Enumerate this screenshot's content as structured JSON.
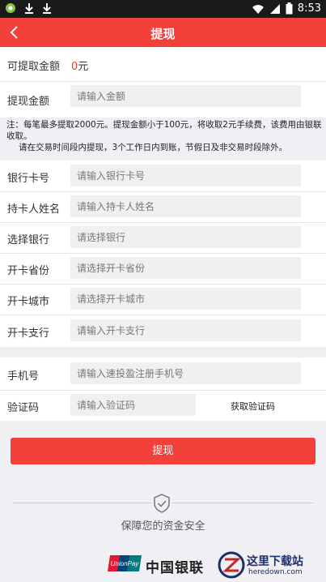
{
  "status": {
    "time": "8:53"
  },
  "header": {
    "title": "提现"
  },
  "available": {
    "label": "可提取金额",
    "value": "0",
    "unit": "元"
  },
  "amount": {
    "label": "提现金额",
    "placeholder": "请输入金额"
  },
  "notice": {
    "line1": "注：每笔最多提取2000元。提现金额小于100元，将收取2元手续费，该费用由银联收取。",
    "line2": "请在交易时间段内提现，3个工作日内到账，节假日及非交易时段除外。"
  },
  "card_number": {
    "label": "银行卡号",
    "placeholder": "请输入银行卡号"
  },
  "holder_name": {
    "label": "持卡人姓名",
    "placeholder": "请输入持卡人姓名"
  },
  "bank": {
    "label": "选择银行",
    "placeholder": "请选择银行"
  },
  "province": {
    "label": "开卡省份",
    "placeholder": "请选择开卡省份"
  },
  "city": {
    "label": "开卡城市",
    "placeholder": "请选择开卡城市"
  },
  "branch": {
    "label": "开卡支行",
    "placeholder": "请输入开卡支行"
  },
  "phone": {
    "label": "手机号",
    "placeholder": "请输入速投盈注册手机号"
  },
  "code": {
    "label": "验证码",
    "placeholder": "请输入验证码",
    "get_code": "获取验证码"
  },
  "submit_label": "提现",
  "security_text": "保障您的资金安全",
  "footer": {
    "unionpay_name": "中国银联",
    "unionpay_logo": "UnionPay 银联"
  },
  "watermark": {
    "title": "这里下载站",
    "url": "heredown.com"
  },
  "colors": {
    "accent": "#f2403a",
    "background": "#efeff4"
  }
}
